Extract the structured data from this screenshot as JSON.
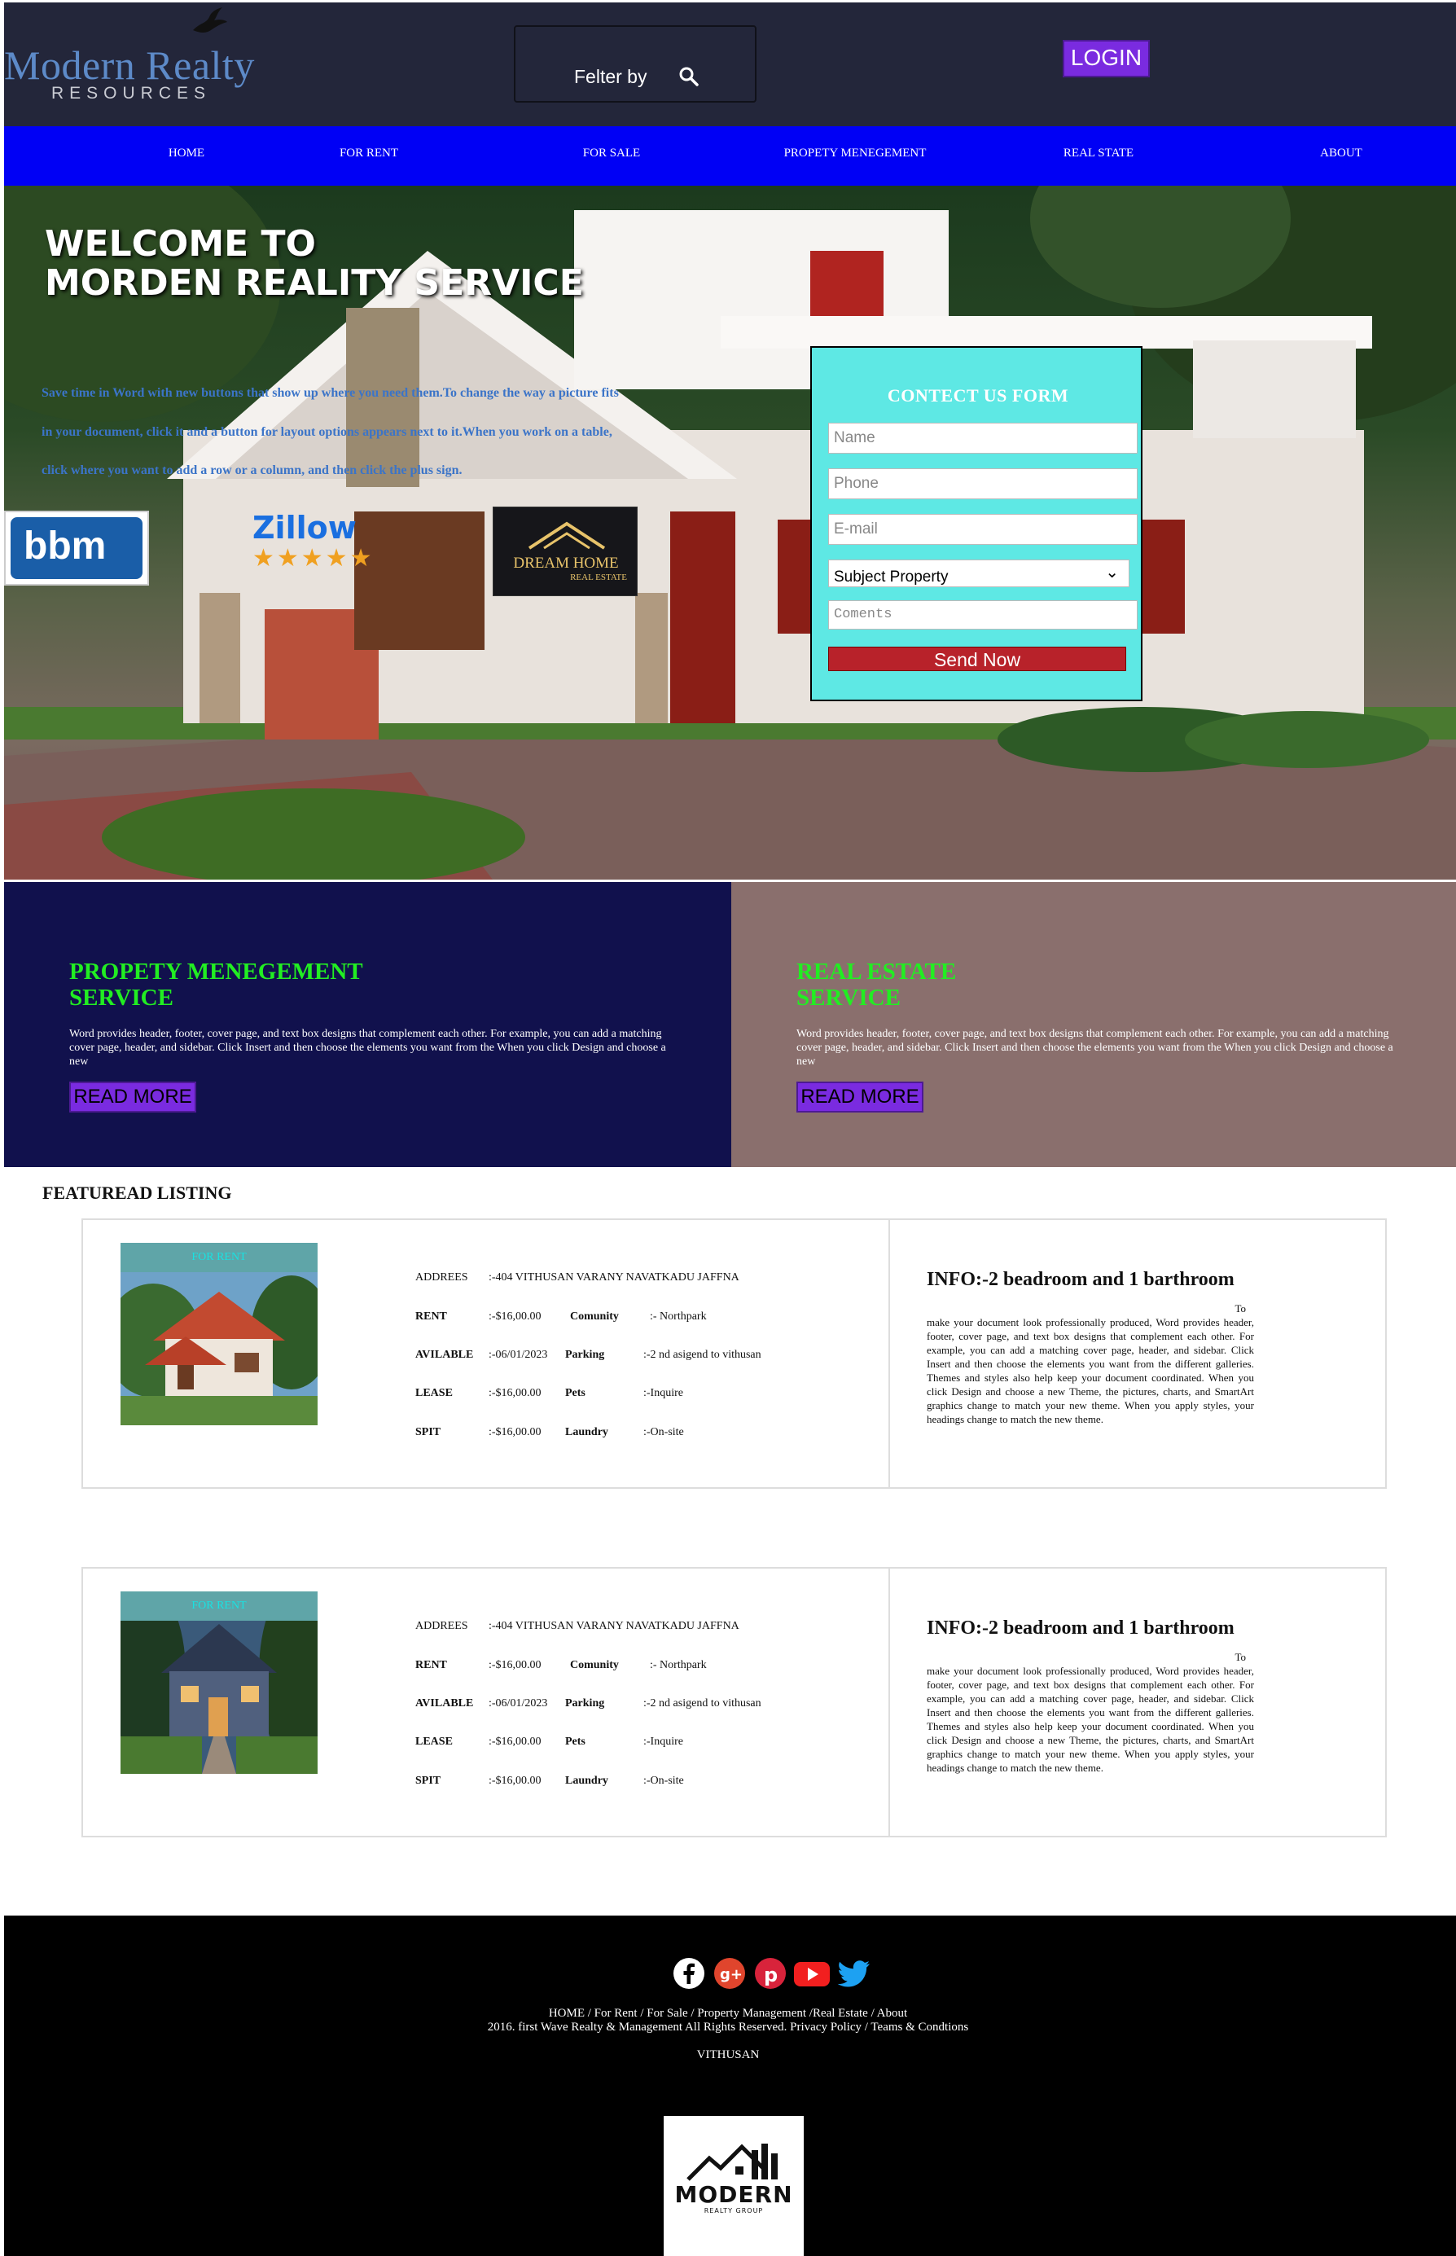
{
  "header": {
    "logo_title": "Modern Realty",
    "logo_subtitle": "RESOURCES",
    "filter_label": "Felter by",
    "login_label": "LOGIN"
  },
  "nav": {
    "items": [
      {
        "label": "HOME"
      },
      {
        "label": "FOR RENT"
      },
      {
        "label": "FOR SALE"
      },
      {
        "label": "PROPETY MENEGEMENT"
      },
      {
        "label": "REAL STATE"
      },
      {
        "label": "ABOUT"
      }
    ]
  },
  "hero": {
    "welcome_line1": "WELCOME TO",
    "welcome_line2": "MORDEN REALITY SERVICE",
    "text_lines": [
      "Save time in Word with new buttons that show up where you need them.To change the way a picture fits",
      "in your document, click it and a button for layout options appears next to it.When you work on a table,",
      "click where you want to add a row or a column, and then click the plus sign."
    ],
    "badges": {
      "bbm": "bbm",
      "zillow": "Zillow",
      "zillow_stars": "★★★★★",
      "dreamhome_title": "DREAM HOME",
      "dreamhome_sub": "REAL ESTATE"
    }
  },
  "contact_form": {
    "title": "CONTECT US FORM",
    "name_placeholder": "Name",
    "phone_placeholder": "Phone",
    "email_placeholder": "E-mail",
    "subject_value": "Subject Property",
    "comments_placeholder": "Coments",
    "send_label": "Send Now"
  },
  "services": [
    {
      "title_line1": "PROPETY MENEGEMENT",
      "title_line2": "SERVICE",
      "body": "Word provides header, footer, cover page, and text box designs that complement each other. For example, you can add a matching cover page, header, and sidebar. Click Insert and then choose the elements you want from the When you click Design and choose a new",
      "button": "READ MORE"
    },
    {
      "title_line1": "REAL ESTATE",
      "title_line2": "SERVICE",
      "body": "Word provides header, footer, cover page, and text box designs that complement each other. For example, you can add a matching cover page, header, and sidebar. Click Insert and then choose the elements you want from the When you click Design and choose a new",
      "button": "READ MORE"
    }
  ],
  "featured": {
    "title": "FEATUREAD LISTING",
    "listings": [
      {
        "tag": "FOR RENT",
        "address_label": "ADDREES",
        "address_value": ":-404 VITHUSAN VARANY NAVATKADU JAFFNA",
        "rent_label": "RENT",
        "rent_value": ":-$16,00.00",
        "community_label": "Comunity",
        "community_value": ":- Northpark",
        "available_label": "AVILABLE",
        "available_value": ":-06/01/2023",
        "parking_label": "Parking",
        "parking_value": ":-2 nd asigend to vithusan",
        "lease_label": "LEASE",
        "lease_value": ":-$16,00.00",
        "pets_label": "Pets",
        "pets_value": ":-Inquire",
        "spit_label": "SPIT",
        "spit_value": ":-$16,00.00",
        "laundry_label": "Laundry",
        "laundry_value": ":-On-site",
        "info_title": "INFO:-2 beadroom and 1 barthroom",
        "info_to": "To",
        "info_body": "make your document look professionally produced, Word provides header, footer, cover page, and text box designs that complement each other. For example, you can add a matching cover page, header, and sidebar. Click Insert and then choose the elements you want from the different galleries. Themes and styles also help keep your document coordinated. When you click Design and choose a new Theme, the pictures, charts, and SmartArt graphics change to match your new theme. When you apply styles, your headings change to match the new theme."
      },
      {
        "tag": "FOR RENT",
        "address_label": "ADDREES",
        "address_value": ":-404 VITHUSAN VARANY NAVATKADU JAFFNA",
        "rent_label": "RENT",
        "rent_value": ":-$16,00.00",
        "community_label": "Comunity",
        "community_value": ":- Northpark",
        "available_label": "AVILABLE",
        "available_value": ":-06/01/2023",
        "parking_label": "Parking",
        "parking_value": ":-2 nd asigend to vithusan",
        "lease_label": "LEASE",
        "lease_value": ":-$16,00.00",
        "pets_label": "Pets",
        "pets_value": ":-Inquire",
        "spit_label": "SPIT",
        "spit_value": ":-$16,00.00",
        "laundry_label": "Laundry",
        "laundry_value": ":-On-site",
        "info_title": "INFO:-2 beadroom and 1 barthroom",
        "info_to": "To",
        "info_body": "make your document look professionally produced, Word provides header, footer, cover page, and text box designs that complement each other. For example, you can add a matching cover page, header, and sidebar. Click Insert and then choose the elements you want from the different galleries. Themes and styles also help keep your document coordinated. When you click Design and choose a new Theme, the pictures, charts, and SmartArt graphics change to match your new theme. When you apply styles, your headings change to match the new theme."
      }
    ]
  },
  "footer": {
    "social_icons": [
      "facebook-icon",
      "google-plus-icon",
      "pinterest-icon",
      "youtube-icon",
      "twitter-icon"
    ],
    "links_text": "HOME / For Rent / For Sale / Property Management /Real Estate / About",
    "copyright_text": "2016. first Wave Realty & Management All Rights Reserved. Privacy Policy / Teams & Condtions",
    "author": "VITHUSAN",
    "logo_text": "MODERN",
    "logo_sub": "REALTY GROUP"
  },
  "colors": {
    "header_bg": "#23263a",
    "nav_bg": "#0000f5",
    "login_bg": "#7a2be0",
    "contact_bg": "#5ee8e4",
    "send_bg": "#b8222a",
    "service_left_bg": "#11114d",
    "service_right_bg": "#8a6f6d",
    "service_title": "#22ee22",
    "footer_bg": "#000000"
  }
}
